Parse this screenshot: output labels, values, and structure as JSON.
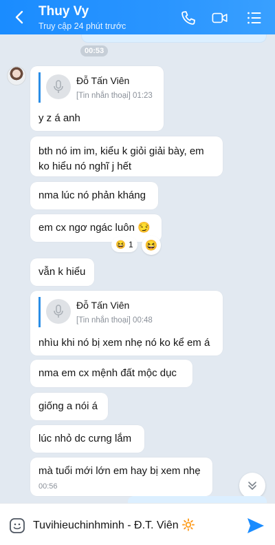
{
  "header": {
    "title": "Thuy Vy",
    "subtitle": "Truy cập 24 phút trước"
  },
  "chat": {
    "prev_time": "00:53",
    "messages": [
      {
        "quote_name": "Đỗ Tấn Viên",
        "quote_sub": "[Tin nhắn thoại] 01:23",
        "text": "y z á anh"
      },
      {
        "text_line1": "bth nó im im, kiểu k giỏi giải bày, em",
        "text_line2": "ko hiểu nó nghĩ j hết"
      },
      {
        "text": "nma lúc nó phản kháng"
      },
      {
        "text": "em cx ngơ ngác luôn 😏",
        "reaction_count": "1"
      },
      {
        "text": "vẫn k hiểu"
      },
      {
        "quote_name": "Đỗ Tấn Viên",
        "quote_sub": "[Tin nhắn thoại] 00:48",
        "text": "nhìu khi nó bị xem nhẹ nó ko kể em á"
      },
      {
        "text": "nma em cx mệnh đất mộc dục"
      },
      {
        "text": "giống a nói á"
      },
      {
        "text": "lúc nhỏ dc cưng lắm"
      },
      {
        "text": "mà tuổi mới lớn em hay bị xem nhẹ",
        "time": "00:56"
      }
    ]
  },
  "input": {
    "value": "Tuvihieuchinhminh - Đ.T. Viên 🔆"
  },
  "colors": {
    "header_blue": "#1a8cff",
    "chat_bg": "#e2e9f1",
    "send_blue": "#1a8cff"
  }
}
